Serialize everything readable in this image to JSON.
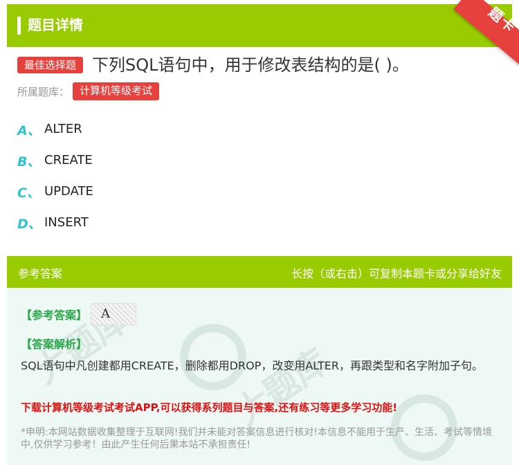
{
  "header": {
    "title": "题目详情"
  },
  "ribbon": {
    "label": "题卡"
  },
  "question": {
    "badge": "最佳选择题",
    "text": "下列SQL语句中，用于修改表结构的是( )。"
  },
  "bank": {
    "label": "所属题库：",
    "name": "计算机等级考试"
  },
  "options": [
    {
      "letter": "A、",
      "text": "ALTER"
    },
    {
      "letter": "B、",
      "text": "CREATE"
    },
    {
      "letter": "C、",
      "text": "UPDATE"
    },
    {
      "letter": "D、",
      "text": "INSERT"
    }
  ],
  "answer": {
    "head_title": "参考答案",
    "head_hint": "长按（或右击）可复制本题卡或分享给好友",
    "ref_label": "【参考答案】",
    "ref_value": "A",
    "analysis_label": "【答案解析】",
    "analysis_text": "SQL语句中凡创建都用CREATE，删除都用DROP，改变用ALTER，再跟类型和名字附加子句。",
    "promo": "下载计算机等级考试考试APP,可以获得系列题目与答案,还有练习等更多学习功能!",
    "disclaimer": "*申明:本网站数据收集整理于互联网!我们并未能对答案信息进行核对!本信息不能用于生产、生活、考试等情境中,仅供学习参考！由此产生任何后果本站不承担责任!"
  },
  "colors": {
    "green": "#99cc00",
    "red": "#e7413d",
    "teal": "#2fc4cc",
    "panel": "#eef8f5"
  }
}
